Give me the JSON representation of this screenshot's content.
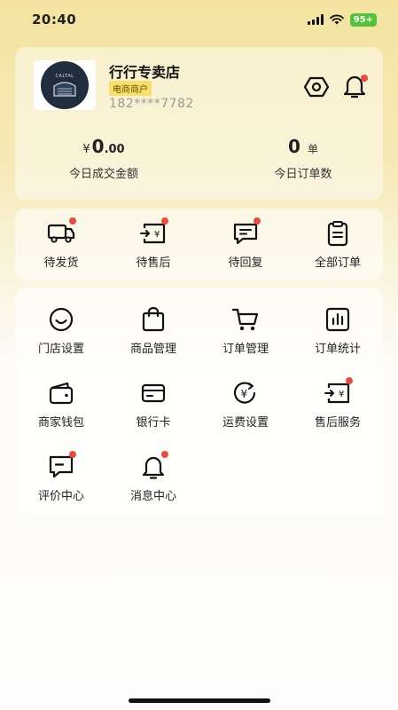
{
  "status": {
    "time": "20:40",
    "battery": "95+"
  },
  "shop": {
    "logo_text": "CALTAL",
    "name": "行行专卖店",
    "badge": "电商商户",
    "phone": "182****7782"
  },
  "stats": {
    "revenue": {
      "prefix": "¥",
      "int": "0",
      "dec": ".00",
      "label": "今日成交金额"
    },
    "orders": {
      "value": "0",
      "unit": "单",
      "label": "今日订单数"
    }
  },
  "order_shortcuts": [
    {
      "label": "待发货",
      "icon": "truck-icon",
      "dot": true
    },
    {
      "label": "待售后",
      "icon": "refund-icon",
      "dot": true
    },
    {
      "label": "待回复",
      "icon": "message-icon",
      "dot": true
    },
    {
      "label": "全部订单",
      "icon": "clipboard-icon",
      "dot": false
    }
  ],
  "tools": [
    {
      "label": "门店设置",
      "icon": "smile-icon",
      "dot": false
    },
    {
      "label": "商品管理",
      "icon": "bag-icon",
      "dot": false
    },
    {
      "label": "订单管理",
      "icon": "cart-icon",
      "dot": false
    },
    {
      "label": "订单统计",
      "icon": "chart-icon",
      "dot": false
    },
    {
      "label": "商家钱包",
      "icon": "wallet-icon",
      "dot": false
    },
    {
      "label": "银行卡",
      "icon": "card-icon",
      "dot": false
    },
    {
      "label": "运费设置",
      "icon": "freight-icon",
      "dot": false
    },
    {
      "label": "售后服务",
      "icon": "refund-icon",
      "dot": true
    },
    {
      "label": "评价中心",
      "icon": "comment-icon",
      "dot": true
    },
    {
      "label": "消息中心",
      "icon": "bell-icon",
      "dot": true
    }
  ]
}
